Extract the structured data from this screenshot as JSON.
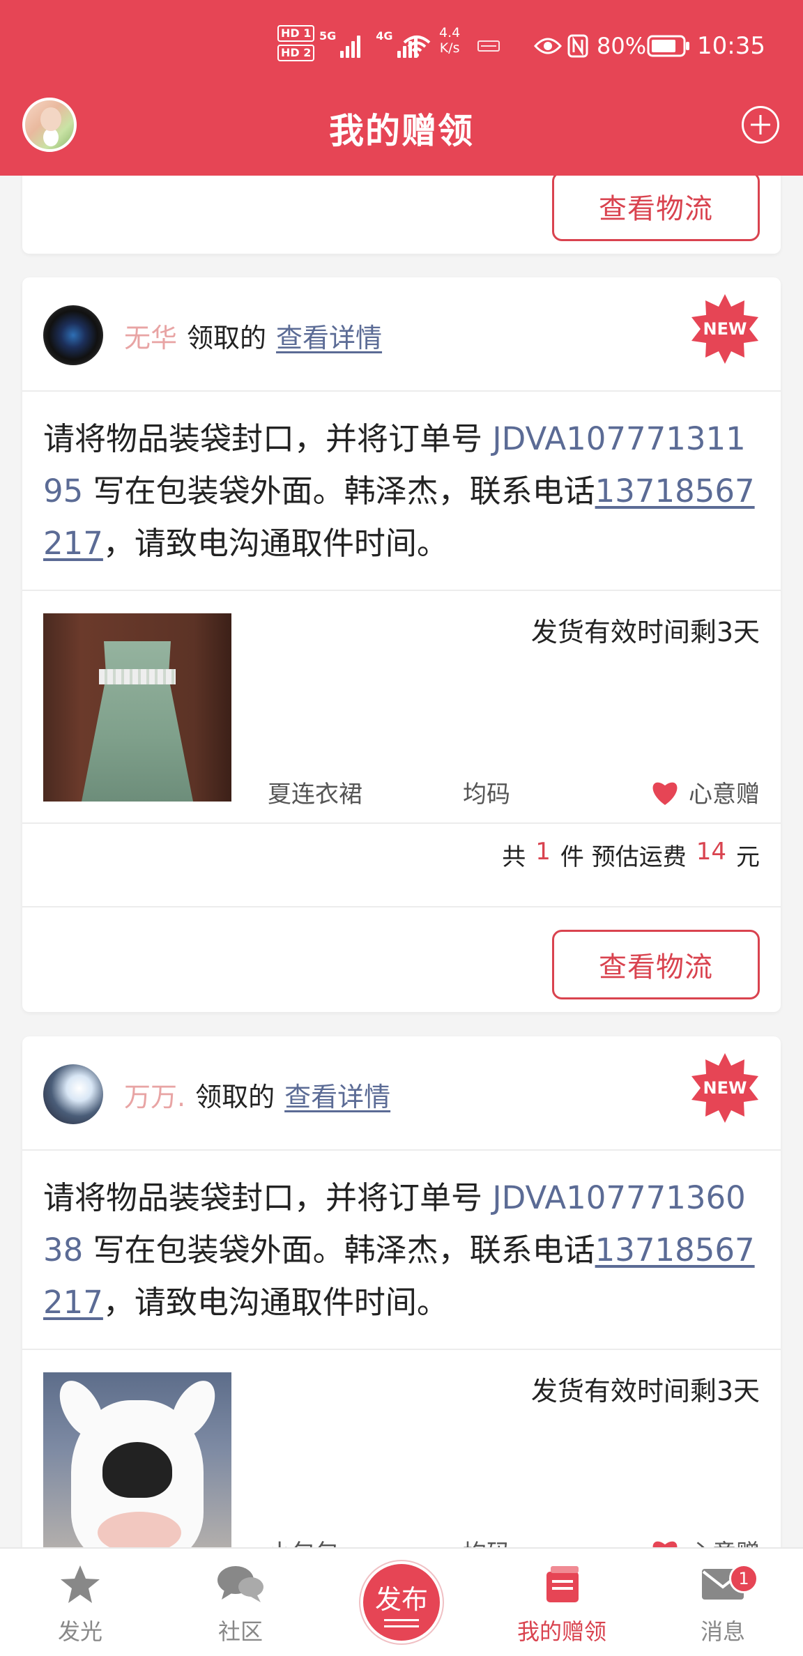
{
  "status_bar": {
    "hd_badges": [
      "HD 1",
      "HD 2"
    ],
    "signal_labels": [
      "5G",
      "4G"
    ],
    "net_speed": "4.4",
    "net_speed_unit": "K/s",
    "battery_pct": "80%",
    "time": "10:35"
  },
  "header": {
    "title": "我的赠领"
  },
  "cards": [
    {
      "button_label": "查看物流"
    },
    {
      "claimer_name": "无华",
      "claimed_word": "领取的",
      "detail_link": "查看详情",
      "new_badge": "NEW",
      "instruction_prefix": "请将物品装袋封口，并将订单号 ",
      "order_no": "JDVA10777131195",
      "instruction_mid": " 写在包装袋外面。韩泽杰，联系电话",
      "phone": "13718567217",
      "instruction_suffix": "，请致电沟通取件时间。",
      "shipping_deadline": "发货有效时间剩3天",
      "item_name": "夏连衣裙",
      "item_size": "均码",
      "gift_type": "心意赠",
      "summary_total_label": "共",
      "summary_count": "1",
      "summary_unit": "件 预估运费",
      "summary_fee": "14",
      "summary_currency": "元",
      "button_label": "查看物流"
    },
    {
      "claimer_name": "万万.",
      "claimed_word": "领取的",
      "detail_link": "查看详情",
      "new_badge": "NEW",
      "instruction_prefix": "请将物品装袋封口，并将订单号 ",
      "order_no": "JDVA10777136038",
      "instruction_mid": " 写在包装袋外面。韩泽杰，联系电话",
      "phone": "13718567217",
      "instruction_suffix": "，请致电沟通取件时间。",
      "shipping_deadline": "发货有效时间剩3天",
      "item_name": "小包包",
      "item_size": "均码",
      "gift_type": "心意赠"
    }
  ],
  "tabbar": {
    "items": [
      {
        "label": "发光",
        "icon": "star-icon",
        "active": false
      },
      {
        "label": "社区",
        "icon": "chat-bubbles-icon",
        "active": false
      },
      {
        "label": "发布",
        "icon": "publish-icon",
        "active": false
      },
      {
        "label": "我的赠领",
        "icon": "gift-book-icon",
        "active": true
      },
      {
        "label": "消息",
        "icon": "mail-icon",
        "active": false,
        "badge": "1"
      }
    ]
  },
  "colors": {
    "brand": "#e64555",
    "accent_text": "#d9434f",
    "link": "#5b6b95",
    "claimer_name": "#e8a4a4"
  }
}
